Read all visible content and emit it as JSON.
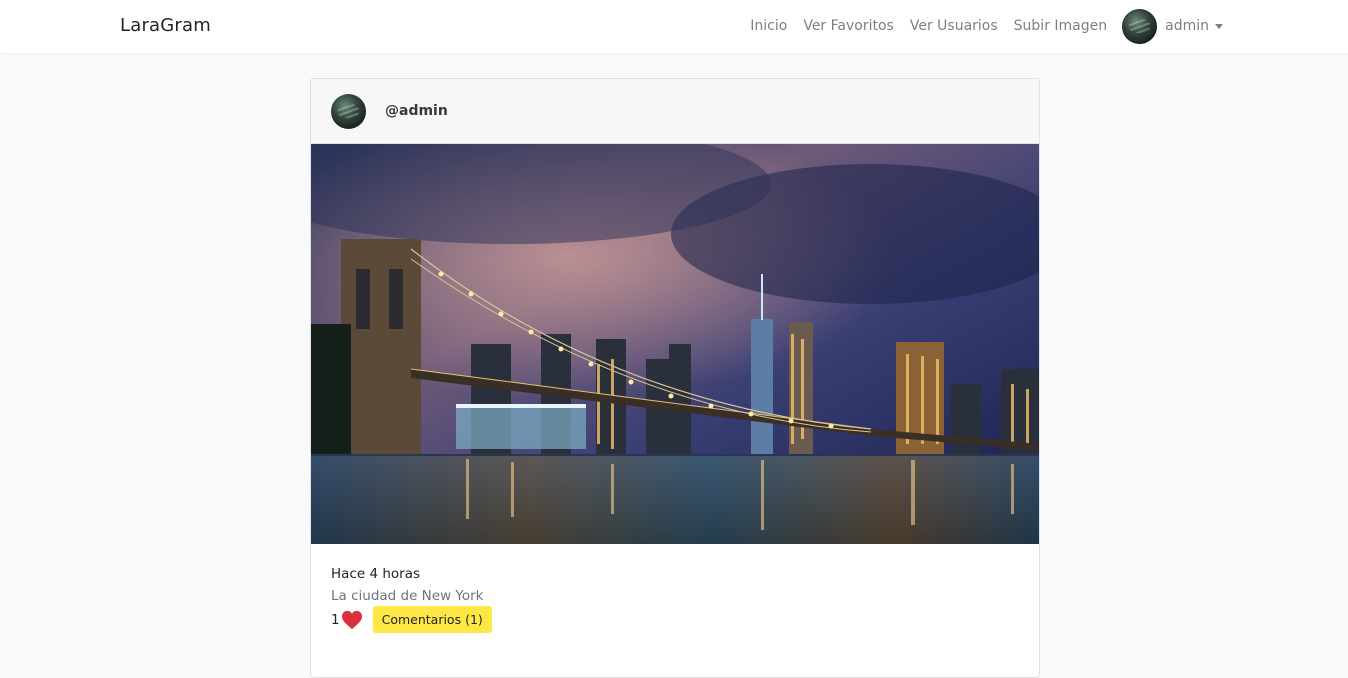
{
  "navbar": {
    "brand": "LaraGram",
    "links": [
      {
        "label": "Inicio"
      },
      {
        "label": "Ver Favoritos"
      },
      {
        "label": "Ver Usuarios"
      },
      {
        "label": "Subir Imagen"
      }
    ],
    "user": {
      "name": "admin"
    }
  },
  "post": {
    "username": "@admin",
    "time_ago": "Hace 4 horas",
    "description": "La ciudad de New York",
    "likes": "1",
    "comments_label": "Comentarios (1)",
    "like_icon": "heart-icon",
    "like_color": "#d9303a",
    "comments_button_color": "#ffe845"
  }
}
